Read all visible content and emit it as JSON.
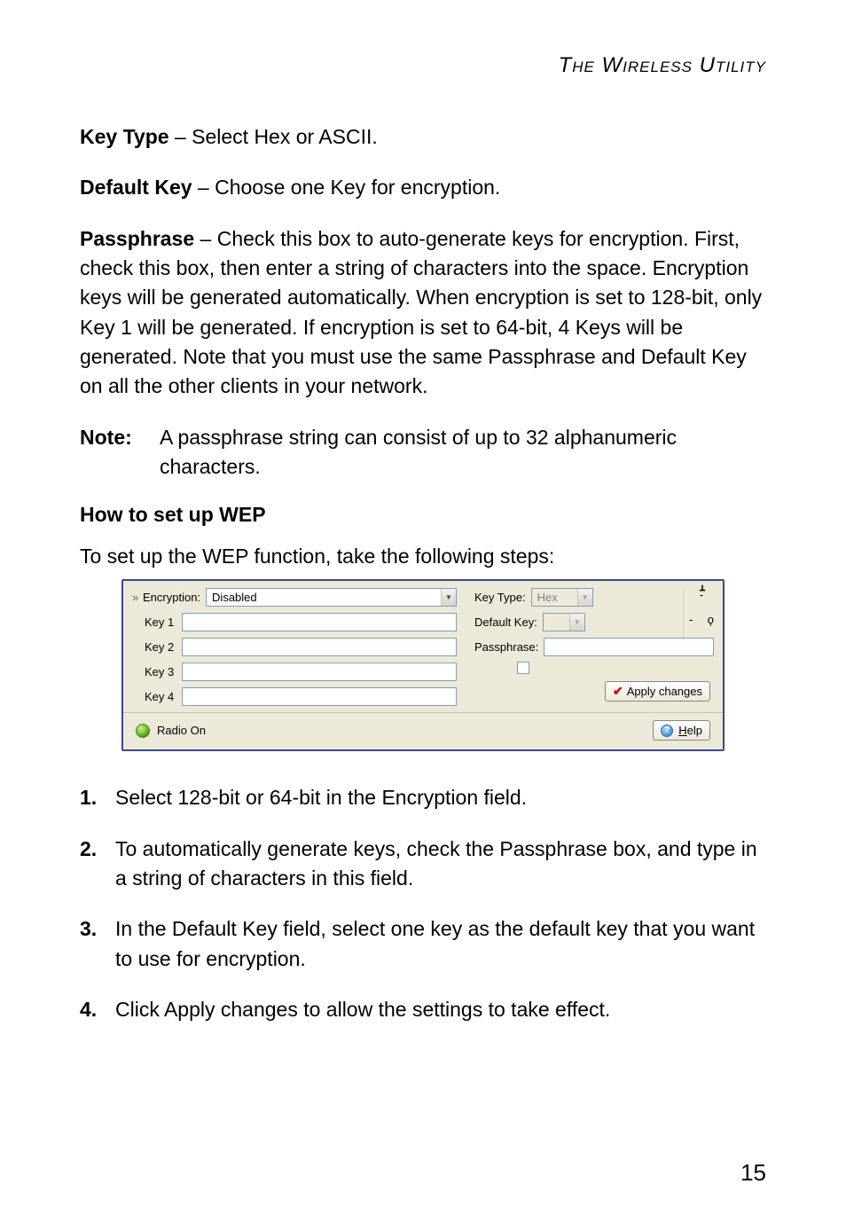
{
  "header": "The Wireless Utility",
  "p_keytype": {
    "term": "Key Type",
    "desc": " – Select Hex or ASCII."
  },
  "p_defaultkey": {
    "term": "Default Key",
    "desc": " – Choose one Key for encryption."
  },
  "p_passphrase": {
    "term": "Passphrase",
    "desc": " – Check this box to auto-generate keys for encryption. First, check this box, then enter a string of characters into the space. Encryption keys will be generated automatically. When encryption is set to 128-bit, only Key 1 will be generated. If encryption is set to 64-bit, 4 Keys will be generated. Note that you must use the same Passphrase and Default Key on all the other clients in your network."
  },
  "note": {
    "label": "Note:",
    "text": "A passphrase string can consist of up to 32 alphanumeric characters."
  },
  "subheading": "How to set up WEP",
  "intro": "To set up the WEP function, take the following steps:",
  "screenshot": {
    "encryption_label": "Encryption:",
    "encryption_value": "Disabled",
    "keys": [
      "Key 1",
      "Key 2",
      "Key 3",
      "Key 4"
    ],
    "keytype_label": "Key Type:",
    "keytype_value": "Hex",
    "defaultkey_label": "Default Key:",
    "passphrase_label": "Passphrase:",
    "apply_label": "Apply changes",
    "radio_label": "Radio On",
    "help_prefix": "H",
    "help_rest": "elp",
    "signal_dash": "-",
    "dash2": "-"
  },
  "steps": [
    {
      "n": "1.",
      "text": "Select 128-bit or 64-bit in the Encryption field."
    },
    {
      "n": "2.",
      "text": "To automatically generate keys, check the Passphrase box, and type in a string of characters in this field."
    },
    {
      "n": "3.",
      "text": "In the Default Key field, select one key as the default key that you want to use for encryption."
    },
    {
      "n": "4.",
      "text": "Click Apply changes to allow the settings to take effect."
    }
  ],
  "page_number": "15"
}
